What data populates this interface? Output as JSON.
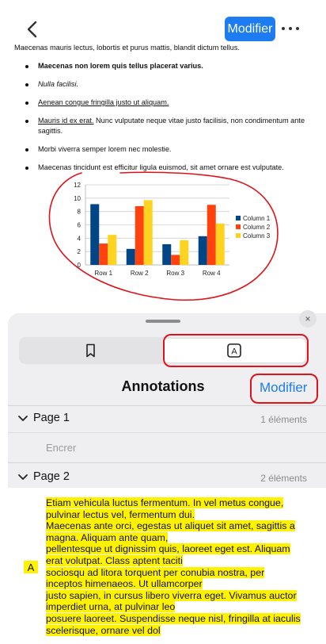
{
  "toolbar": {
    "modify_label": "Modifier"
  },
  "document": {
    "line0": "Maecenas mauris lectus, lobortis et purus mattis, blandit dictum tellus.",
    "bullets": [
      {
        "text": "Maecenas non lorem quis tellus placerat varius."
      },
      {
        "text": "Nulla facilisi."
      },
      {
        "text": "Aenean congue fringilla justo ut aliquam. "
      },
      {
        "underlined": "Mauris id ex erat.",
        "rest": " Nunc vulputate neque vitae justo facilisis, non condimentum ante sagittis."
      },
      {
        "text": "Morbi viverra semper lorem nec molestie."
      },
      {
        "text": "Maecenas tincidunt est efficitur ligula euismod, sit amet ornare est vulputate."
      }
    ]
  },
  "chart_data": {
    "type": "bar",
    "categories": [
      "Row 1",
      "Row 2",
      "Row 3",
      "Row 4"
    ],
    "series": [
      {
        "name": "Column 1",
        "values": [
          9.1,
          2.4,
          3.1,
          4.3
        ],
        "color": "#004586"
      },
      {
        "name": "Column 2",
        "values": [
          3.2,
          8.8,
          1.5,
          9.0
        ],
        "color": "#ff420e"
      },
      {
        "name": "Column 3",
        "values": [
          4.5,
          9.7,
          3.7,
          6.2
        ],
        "color": "#ffd320"
      }
    ],
    "ylim": [
      0,
      12
    ],
    "yticks": [
      "0",
      "2",
      "4",
      "6",
      "8",
      "10",
      "12"
    ],
    "grid": true,
    "legend": "right",
    "title": "",
    "xlabel": "",
    "ylabel": ""
  },
  "panel": {
    "title": "Annotations",
    "modify_label": "Modifier",
    "close_icon": "×",
    "annot_tab_icon": "A",
    "pages": [
      {
        "label": "Page 1",
        "count": "1 éléments",
        "items": [
          "Encrer"
        ]
      },
      {
        "label": "Page 2",
        "count": "2 éléments"
      }
    ],
    "marker": "A",
    "highlight_lines": [
      "Etiam vehicula luctus fermentum. In vel metus congue,",
      "pulvinar lectus vel, fermentum dui.",
      "Maecenas ante orci, egestas ut aliquet sit amet, sagittis a",
      "magna. Aliquam ante quam,",
      "pellentesque ut dignissim quis, laoreet eget est. Aliquam",
      "erat volutpat. Class aptent taciti",
      "sociosqu ad litora torquent per conubia nostra, per",
      "inceptos himenaeos. Ut ullamcorper",
      "justo sapien, in cursus libero viverra eget. Vivamus auctor",
      "imperdiet urna, at pulvinar leo",
      "posuere laoreet. Suspendisse neque nisl, fringilla at iaculis",
      "scelerisque, ornare vel dol"
    ],
    "accent_color": "#1e7cf2",
    "highlight_color": "#fff200",
    "callout_color": "#e0121a"
  }
}
